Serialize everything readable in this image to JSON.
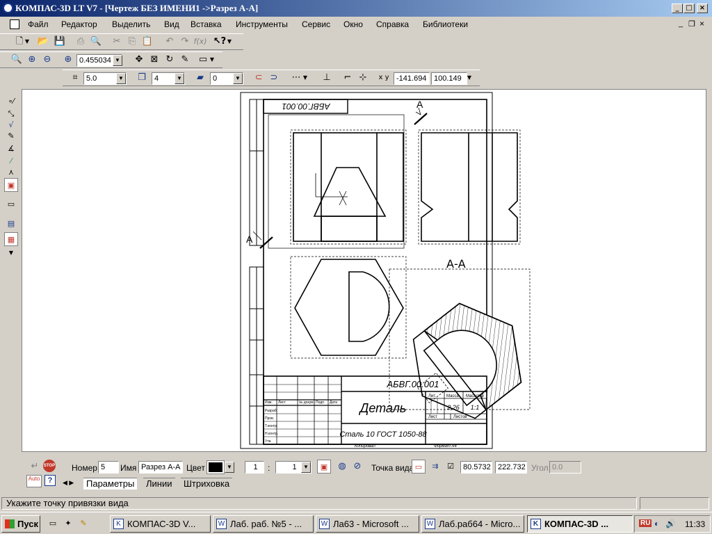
{
  "window": {
    "title": "КОМПАС-3D LT V7 - [Чертеж БЕЗ ИМЕНИ1 ->Разрез А-А]",
    "minimize": "_",
    "maximize": "□",
    "close": "×"
  },
  "menu": [
    "Файл",
    "Редактор",
    "Выделить",
    "Вид",
    "Вставка",
    "Инструменты",
    "Сервис",
    "Окно",
    "Справка",
    "Библиотеки"
  ],
  "view_toolbar": {
    "zoom_value": "0.455034"
  },
  "current_state": {
    "step_value": "5.0",
    "layer_value": "4",
    "style_value": "0",
    "coord_x": "-141.694",
    "coord_y": "100.149"
  },
  "drawing": {
    "stamp_code": "АБВГ.00.001",
    "stamp_code_rotated": "АБВГ.00.001",
    "section_label": "А-А",
    "cut_letter_top": "А",
    "cut_letter_left": "А",
    "part_name": "Деталь",
    "material": "Сталь 10  ГОСТ 1050-88",
    "scale_weight": "2,26",
    "scale": "1:1",
    "copied": "Копировал",
    "format": "Формат   А4",
    "lit": "Лит.",
    "mass": "Масса",
    "scale_hdr": "Масштаб",
    "sheet": "Лист",
    "sheets": "Листов",
    "rows": [
      "Изм.",
      "Лист",
      "№ докум.",
      "Подп.",
      "Дата"
    ],
    "roles": [
      "Разраб.",
      "Пров.",
      "Т.контр.",
      "",
      "Н.контр.",
      "Утв."
    ]
  },
  "view_params": {
    "number_label": "Номер",
    "number_value": "5",
    "name_label": "Имя",
    "name_value": "Разрез А-А",
    "color_label": "Цвет",
    "scale_left": "1",
    "scale_sep": ":",
    "scale_right": "1",
    "point_label": "Точка вида",
    "point_x": "80.5732",
    "point_y": "222.732",
    "angle_label": "Угол",
    "angle_value": "0.0",
    "tabs": [
      "Параметры",
      "Линии",
      "Штриховка"
    ],
    "auto_label": "Auto",
    "stop_label": "STOP"
  },
  "status": {
    "text": "Укажите точку привязки вида"
  },
  "taskbar": {
    "start": "Пуск",
    "tasks": [
      "КОМПАС-3D V...",
      "Лаб. раб. №5 - ...",
      "Ла63 - Microsoft ...",
      "Лаб.раб64 - Micro...",
      "КОМПАС-3D ..."
    ],
    "lang": "RU",
    "clock": "11:33"
  },
  "colors": {
    "title_start": "#0a246a",
    "title_end": "#a6caf0",
    "face": "#d4d0c8",
    "accent": "#c0392b"
  }
}
